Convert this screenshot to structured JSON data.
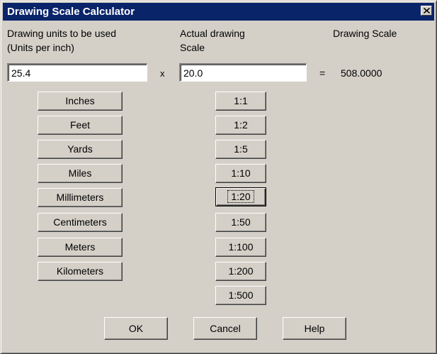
{
  "window": {
    "title": "Drawing Scale Calculator",
    "close_icon": "close-icon"
  },
  "labels": {
    "units_line1": "Drawing units to be used",
    "units_line2": "(Units per inch)",
    "actual_line1": "Actual drawing",
    "actual_line2": "Scale",
    "scale_heading": "Drawing Scale",
    "multiply": "x",
    "equals": "=",
    "scale_result": "508.0000"
  },
  "inputs": {
    "units_value": "25.4",
    "scale_value": "20.0"
  },
  "unit_buttons": [
    "Inches",
    "Feet",
    "Yards",
    "Miles",
    "Millimeters",
    "Centimeters",
    "Meters",
    "Kilometers"
  ],
  "scale_buttons": [
    "1:1",
    "1:2",
    "1:5",
    "1:10",
    "1:20",
    "1:50",
    "1:100",
    "1:200",
    "1:500"
  ],
  "focused_scale": "1:20",
  "actions": {
    "ok": "OK",
    "cancel": "Cancel",
    "help": "Help"
  },
  "colors": {
    "titlebar": "#0a246a",
    "face": "#d4d0c8"
  }
}
